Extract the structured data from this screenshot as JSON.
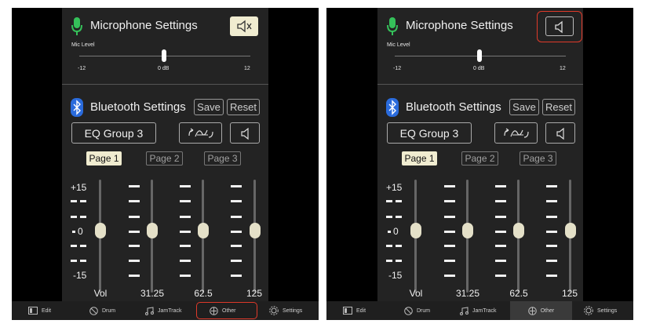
{
  "screens": [
    {
      "mic": {
        "title": "Microphone Settings",
        "level_label": "Mic Level",
        "min": "-12",
        "mid": "0 dB",
        "max": "12",
        "level_db": 0,
        "muted": true
      },
      "bt": {
        "title": "Bluetooth Settings",
        "save": "Save",
        "reset": "Reset",
        "eq_group": "EQ Group 3"
      },
      "pages": [
        "Page 1",
        "Page 2",
        "Page 3"
      ],
      "active_page": "Page 1",
      "scale": {
        "top": "+15",
        "mid": "0",
        "bottom": "-15"
      },
      "channels": [
        {
          "label": "Vol",
          "value": 0
        },
        {
          "label": "31.25",
          "value": 0
        },
        {
          "label": "62.5",
          "value": 0
        },
        {
          "label": "125",
          "value": 0
        }
      ],
      "nav": [
        "Edit",
        "Drum",
        "JamTrack",
        "Other",
        "Settings"
      ],
      "highlight": "Other tab"
    },
    {
      "mic": {
        "title": "Microphone Settings",
        "level_label": "Mic Level",
        "min": "-12",
        "mid": "0 dB",
        "max": "12",
        "level_db": 0,
        "muted": false
      },
      "bt": {
        "title": "Bluetooth Settings",
        "save": "Save",
        "reset": "Reset",
        "eq_group": "EQ Group 3"
      },
      "pages": [
        "Page 1",
        "Page 2",
        "Page 3"
      ],
      "active_page": "Page 1",
      "scale": {
        "top": "+15",
        "mid": "0",
        "bottom": "-15"
      },
      "channels": [
        {
          "label": "Vol",
          "value": 0
        },
        {
          "label": "31.25",
          "value": 0
        },
        {
          "label": "62.5",
          "value": 0
        },
        {
          "label": "125",
          "value": 0
        }
      ],
      "nav": [
        "Edit",
        "Drum",
        "JamTrack",
        "Other",
        "Settings"
      ],
      "highlight": "Mic mute button"
    }
  ],
  "colors": {
    "highlight": "#e03a2a",
    "mic_green": "#35c15a",
    "bt_blue": "#2a6bdc",
    "active_bg": "#f0ecd0"
  }
}
